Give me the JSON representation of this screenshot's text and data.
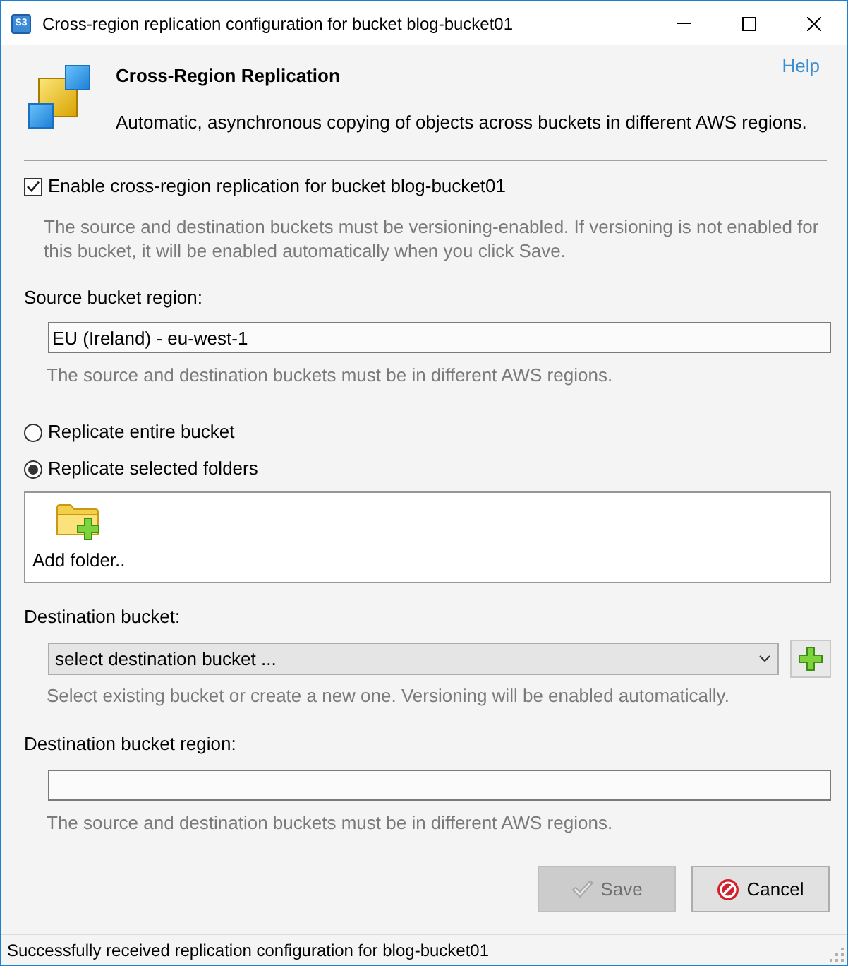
{
  "window": {
    "icon_label": "S3",
    "title": "Cross-region replication configuration for bucket blog-bucket01"
  },
  "header": {
    "title": "Cross-Region Replication",
    "subtitle": "Automatic, asynchronous copying of objects across buckets in different AWS regions.",
    "help": "Help"
  },
  "enable": {
    "label": "Enable cross-region replication for bucket blog-bucket01",
    "checked": true,
    "hint": "The source and destination buckets must be versioning-enabled. If versioning is not enabled for this bucket, it will be enabled automatically when you click Save."
  },
  "source_region": {
    "label": "Source bucket region:",
    "value": "EU (Ireland) - eu-west-1",
    "hint": "The source and destination buckets must be in different AWS regions."
  },
  "scope_options": [
    {
      "label": "Replicate entire bucket",
      "selected": false
    },
    {
      "label": "Replicate selected folders",
      "selected": true
    }
  ],
  "folders": {
    "add_label": "Add folder.."
  },
  "destination_bucket": {
    "label": "Destination bucket:",
    "value": "select destination bucket ...",
    "hint": "Select existing bucket or create a new one. Versioning will be enabled automatically."
  },
  "destination_region": {
    "label": "Destination bucket region:",
    "hint": "The source and destination buckets must be in different AWS regions."
  },
  "buttons": [
    {
      "kind": "save",
      "label": "Save",
      "disabled": true
    },
    {
      "kind": "cancel",
      "label": "Cancel",
      "disabled": false
    }
  ],
  "status_bar": "Successfully received replication configuration for blog-bucket01"
}
